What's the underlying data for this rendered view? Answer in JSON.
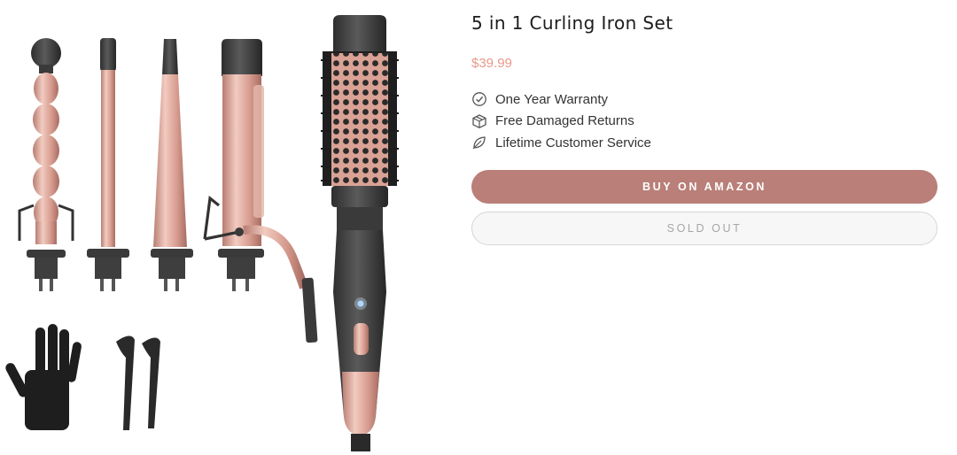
{
  "product": {
    "title": "5 in 1 Curling Iron Set",
    "price": "$39.99",
    "image_alt": "Curling iron set with interchangeable barrels, brush, glove and clips"
  },
  "features": [
    {
      "icon": "check-circle-icon",
      "label": "One Year Warranty"
    },
    {
      "icon": "box-icon",
      "label": "Free Damaged Returns"
    },
    {
      "icon": "leaf-icon",
      "label": "Lifetime Customer Service"
    }
  ],
  "buttons": {
    "buy": "BUY ON AMAZON",
    "sold_out": "SOLD OUT"
  },
  "colors": {
    "accent": "#b97f78",
    "price": "#e99889",
    "rose_gold": "#dba79a",
    "dark": "#3a3a3a"
  }
}
